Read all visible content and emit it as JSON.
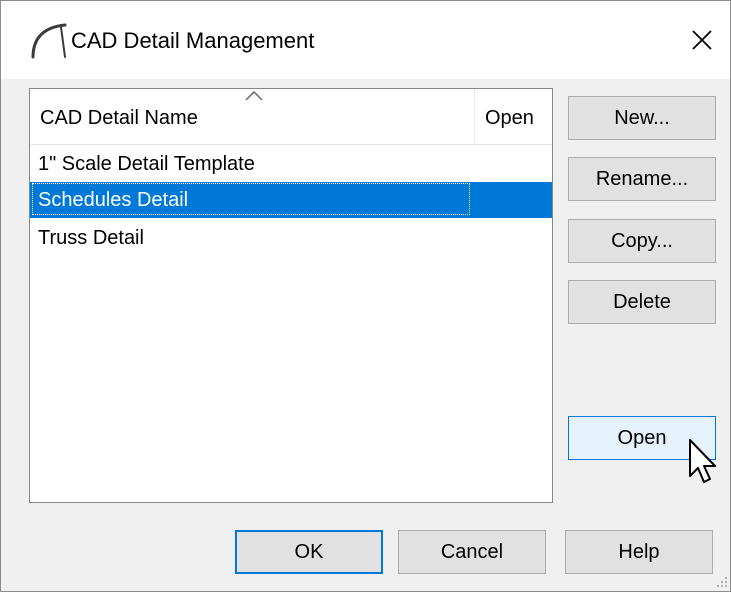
{
  "window": {
    "title": "CAD Detail Management"
  },
  "list": {
    "columns": [
      {
        "label": "CAD Detail Name"
      },
      {
        "label": "Open"
      }
    ],
    "rows": [
      {
        "name": "1\" Scale Detail Template",
        "open": ""
      },
      {
        "name": "Schedules Detail",
        "open": ""
      },
      {
        "name": "Truss Detail",
        "open": ""
      }
    ],
    "selected_index": 1
  },
  "side_buttons": {
    "new": "New...",
    "rename": "Rename...",
    "copy": "Copy...",
    "delete": "Delete",
    "open": "Open"
  },
  "footer_buttons": {
    "ok": "OK",
    "cancel": "Cancel",
    "help": "Help"
  },
  "colors": {
    "selection": "#0078d7",
    "button_face": "#e1e1e1",
    "button_hover": "#e5f1fb",
    "dialog_bg": "#f0f0f0"
  },
  "icons": {
    "app": "arc-icon",
    "close": "close-icon",
    "sort": "sort-ascending-icon",
    "cursor": "mouse-pointer-icon",
    "grip": "resize-grip-icon"
  }
}
